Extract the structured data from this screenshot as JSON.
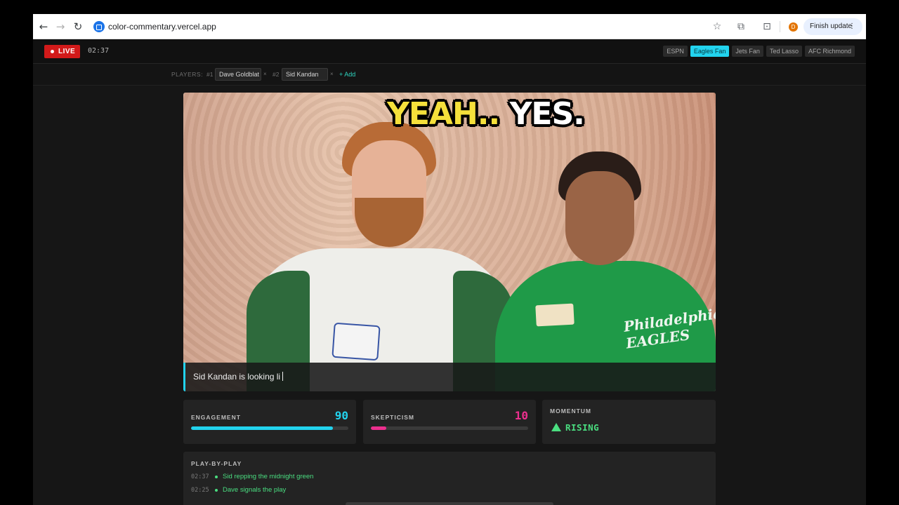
{
  "browser": {
    "url": "color-commentary.vercel.app",
    "profile_initial": "D",
    "finish_update_label": "Finish update"
  },
  "header": {
    "live_label": "LIVE",
    "timer": "02:37",
    "modes": [
      "ESPN",
      "Eagles Fan",
      "Jets Fan",
      "Ted Lasso",
      "AFC Richmond"
    ],
    "active_mode": "Eagles Fan"
  },
  "players": {
    "label": "PLAYERS:",
    "list": [
      {
        "number": "#1",
        "name": "Dave Goldblat"
      },
      {
        "number": "#2",
        "name": "Sid Kandan"
      }
    ],
    "remove_symbol": "×",
    "add_label": "+ Add"
  },
  "video": {
    "caption_yellow": "YEAH..",
    "caption_white": "YES.",
    "jersey_text": "Philadelphia EAGLES",
    "commentary": "Sid Kandan is looking li"
  },
  "stats": {
    "engagement": {
      "label": "ENGAGEMENT",
      "value": "90",
      "percent": 90,
      "color": "#22d3ee"
    },
    "skepticism": {
      "label": "SKEPTICISM",
      "value": "10",
      "percent": 10,
      "color": "#ec2f8e"
    },
    "momentum": {
      "label": "MOMENTUM",
      "value": "RISING",
      "color": "#4ade80"
    }
  },
  "play_by_play": {
    "title": "PLAY-BY-PLAY",
    "items": [
      {
        "time": "02:37",
        "text": "Sid repping the midnight green"
      },
      {
        "time": "02:25",
        "text": "Dave signals the play"
      }
    ]
  }
}
